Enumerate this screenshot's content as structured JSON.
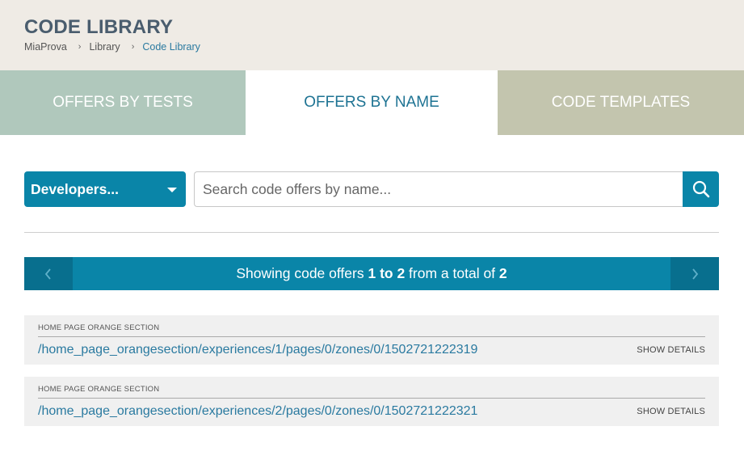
{
  "header": {
    "title": "CODE LIBRARY",
    "breadcrumb": [
      {
        "label": "MiaProva"
      },
      {
        "label": "Library"
      },
      {
        "label": "Code Library"
      }
    ],
    "breadcrumb_separator": "›"
  },
  "tabs": [
    {
      "label": "OFFERS BY TESTS",
      "active": false
    },
    {
      "label": "OFFERS BY NAME",
      "active": true
    },
    {
      "label": "CODE TEMPLATES",
      "active": false
    }
  ],
  "filter": {
    "dropdown_value": "Developers..."
  },
  "search": {
    "placeholder": "Search code offers by name...",
    "value": ""
  },
  "pager": {
    "prefix": "Showing code offers ",
    "range": "1 to 2",
    "middle": " from a total of ",
    "total": "2"
  },
  "offers": [
    {
      "section": "HOME PAGE ORANGE SECTION",
      "path": "/home_page_orangesection/experiences/1/pages/0/zones/0/1502721222319",
      "action": "SHOW DETAILS"
    },
    {
      "section": "HOME PAGE ORANGE SECTION",
      "path": "/home_page_orangesection/experiences/2/pages/0/zones/0/1502721222321",
      "action": "SHOW DETAILS"
    }
  ],
  "colors": {
    "accent": "#0a85a8",
    "header_bg": "#efebe5",
    "tab_tests_bg": "#b0c8bc",
    "tab_templates_bg": "#c3c5ae",
    "link": "#2a7aa0"
  },
  "icons": {
    "search": "search-icon",
    "prev": "chevron-left-icon",
    "next": "chevron-right-icon",
    "dropdown": "caret-down-icon"
  }
}
